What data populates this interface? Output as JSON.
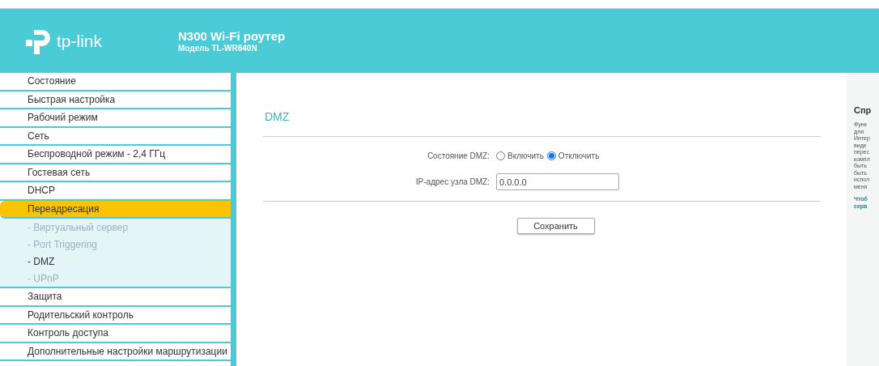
{
  "header": {
    "brand": "tp-link",
    "title": "N300 Wi-Fi роутер",
    "model": "Модель TL-WR840N"
  },
  "sidebar": {
    "items": [
      {
        "label": "Состояние",
        "selected": false
      },
      {
        "label": "Быстрая настройка",
        "selected": false
      },
      {
        "label": "Рабочий режим",
        "selected": false
      },
      {
        "label": "Сеть",
        "selected": false
      },
      {
        "label": "Беспроводной режим - 2,4 ГГц",
        "selected": false
      },
      {
        "label": "Гостевая сеть",
        "selected": false
      },
      {
        "label": "DHCP",
        "selected": false
      },
      {
        "label": "Переадресация",
        "selected": true,
        "children": [
          {
            "label": "- Виртуальный сервер",
            "selected": false
          },
          {
            "label": "- Port Triggering",
            "selected": false
          },
          {
            "label": "- DMZ",
            "selected": true
          },
          {
            "label": "- UPnP",
            "selected": false
          }
        ]
      },
      {
        "label": "Защита",
        "selected": false
      },
      {
        "label": "Родительский контроль",
        "selected": false
      },
      {
        "label": "Контроль доступа",
        "selected": false
      },
      {
        "label": "Дополнительные настройки маршрутизации",
        "selected": false
      }
    ]
  },
  "main": {
    "title": "DMZ",
    "status": {
      "label": "Состояние DMZ:",
      "options": [
        {
          "label": "Включить",
          "selected": false
        },
        {
          "label": "Отключить",
          "selected": true
        }
      ]
    },
    "ip": {
      "label": "IP-адрес узла DMZ:",
      "value": "0.0.0.0"
    },
    "save": "Сохранить"
  },
  "help": {
    "title": "Спр",
    "lines": [
      "Функ",
      "для",
      "Интер",
      "виде",
      "перес",
      "компл",
      "быть",
      "быть",
      "испол",
      "меня"
    ],
    "bold_lines": [
      "Чтоб",
      "серв"
    ]
  }
}
